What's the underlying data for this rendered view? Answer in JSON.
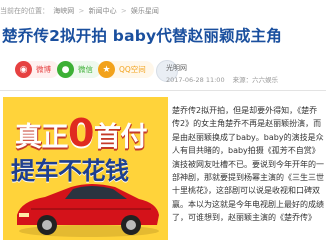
{
  "breadcrumb": {
    "items": [
      "当前在的位置：",
      "海峡网",
      ">",
      "新闻中心",
      ">",
      "娱乐星闻"
    ]
  },
  "article": {
    "title": "楚乔传2拟开拍 baby代替赵丽颖成主角",
    "author": "光明网",
    "date": "2017-06-28 11:00",
    "source": "来源：六六娱乐",
    "paragraph": "楚乔传2拟开拍，但是却要外得知，《楚乔传2》的女主角楚乔不再是赵丽颖扮演，而是由赵丽颖换成了baby。baby的演技是众人有目共睹的，baby拍摄《孤芳不自赏》演技被网友吐槽不已。要说到今年开年的一部神剧，那就要提到杨幂主演的《三生三世十里桃花》，这部剧可以说是收视和口碑双赢。本以为这就是今年电视剧上最好的成绩了，可谁想到，赵丽颖主演的《楚乔传》"
  },
  "share": {
    "weibo_label": "微博",
    "weixin_label": "微信",
    "qzone_label": "QQ空间"
  },
  "ad": {
    "line1_a": "真正",
    "line1_b": "0",
    "line1_c": "首付",
    "line2": "提车不花钱"
  },
  "colors": {
    "title_blue": "#1a4f9e",
    "ad_yellow": "#ffd33a",
    "ad_red": "#e02a1f"
  }
}
